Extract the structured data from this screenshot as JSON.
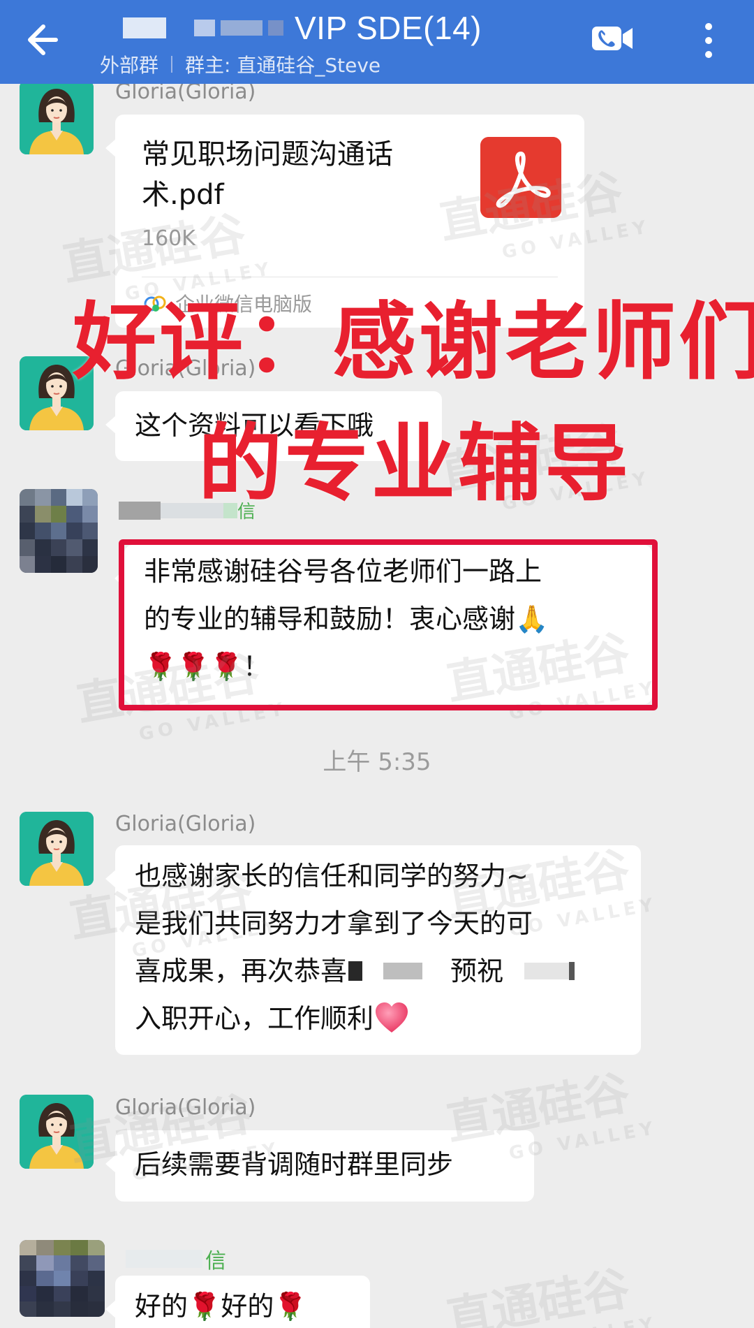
{
  "colors": {
    "header_bg": "#3d78d8",
    "chat_bg": "#ededed",
    "overlay_red": "#e8202f",
    "highlight_border": "#e0103a",
    "avatar_teal": "#20b59a",
    "pdf_red": "#e53a2f"
  },
  "header": {
    "title": "VIP SDE(14)",
    "group_type": "外部群",
    "owner": "群主: 直通硅谷_Steve",
    "icons": [
      "back-arrow-icon",
      "video-call-icon",
      "more-icon"
    ]
  },
  "overlay": {
    "line1": "好评：感谢老师们",
    "line2": "的专业辅导"
  },
  "watermark": {
    "text": "直通硅谷",
    "sub": "GO VALLEY"
  },
  "messages": [
    {
      "sender": "Gloria(Gloria)",
      "type": "file",
      "file_name": "常见职场问题沟通话术.pdf",
      "file_size": "160K",
      "file_source": "企业微信电脑版"
    },
    {
      "sender": "Gloria(Gloria)",
      "type": "text",
      "text": "这个资料可以看下哦"
    },
    {
      "sender": "",
      "sender_suffix": "信",
      "type": "text",
      "lines": [
        "非常感谢硅谷号各位老师们一路上",
        "的专业的辅导和鼓励！衷心感谢🙏",
        "🌹🌹🌹！"
      ]
    },
    {
      "type": "timestamp",
      "text": "上午 5:35"
    },
    {
      "sender": "Gloria(Gloria)",
      "type": "text",
      "lines": [
        "也感谢家长的信任和同学的努力~",
        "是我们共同努力才拿到了今天的可",
        "喜成果，再次恭喜",
        "预祝",
        "入职开心，工作顺利"
      ]
    },
    {
      "sender": "Gloria(Gloria)",
      "type": "text",
      "text": "后续需要背调随时群里同步"
    },
    {
      "sender": "",
      "sender_suffix": "信",
      "type": "text",
      "text": "好的🌹好的🌹"
    }
  ]
}
